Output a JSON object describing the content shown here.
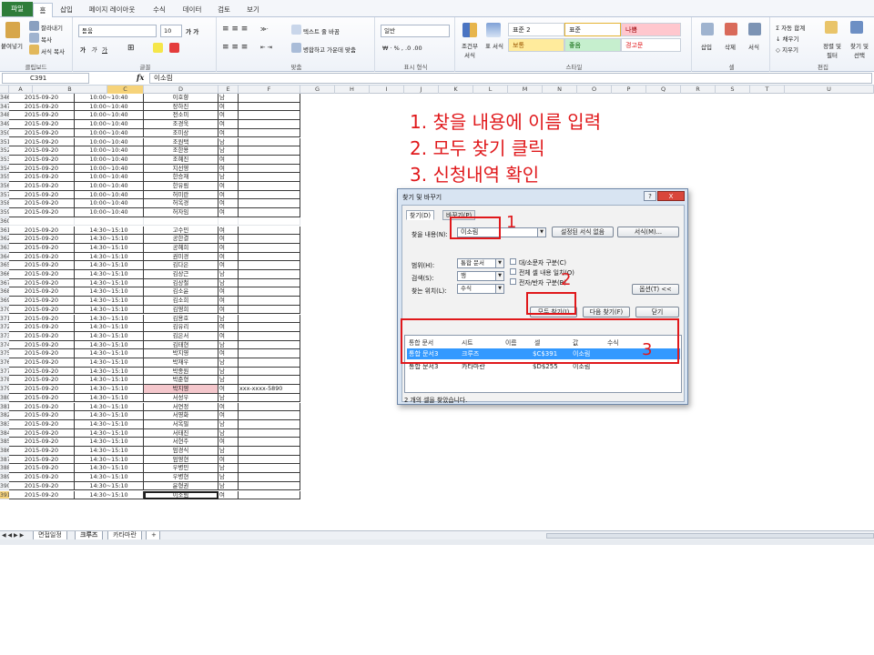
{
  "ribbon": {
    "tabs": [
      "파일",
      "홈",
      "삽입",
      "페이지 레이아웃",
      "수식",
      "데이터",
      "검토",
      "보기"
    ],
    "clipboard": {
      "paste": "붙여넣기",
      "cut": "잘라내기",
      "copy": "복사",
      "format_painter": "서식 복사",
      "label": "클립보드"
    },
    "font": {
      "name": "돋움",
      "size": "10",
      "label": "글꼴"
    },
    "alignment": {
      "wrap": "텍스트 줄 바꿈",
      "merge": "병합하고 가운데 맞춤",
      "label": "맞춤"
    },
    "number": {
      "format": "일반",
      "label": "표시 형식"
    },
    "styles": {
      "conditional": "조건부 서식",
      "table": "표 서식",
      "cells": [
        "표준 2",
        "표준",
        "나쁨",
        "보통",
        "좋음",
        "경고문"
      ],
      "label": "스타일"
    },
    "cells": {
      "insert": "삽입",
      "delete": "삭제",
      "format": "서식",
      "label": "셀"
    },
    "editing": {
      "autosum": "자동 합계",
      "fill": "채우기",
      "clear": "지우기",
      "sort": "정렬 및 필터",
      "find": "찾기 및 선택",
      "label": "편집"
    }
  },
  "formula_bar": {
    "name_box": "C391",
    "fx": "fx",
    "content": "이소림"
  },
  "columns": [
    "A",
    "B",
    "C",
    "D",
    "E",
    "F",
    "G",
    "H",
    "I",
    "J",
    "K",
    "L",
    "M",
    "N",
    "O",
    "P",
    "Q",
    "R",
    "S",
    "T",
    "U"
  ],
  "rows": [
    {
      "num": "346",
      "a": "2015-09-20",
      "b": "10:00~10:40",
      "c": "이호향",
      "d": "남"
    },
    {
      "num": "347",
      "a": "2015-09-20",
      "b": "10:00~10:40",
      "c": "장하진",
      "d": "여"
    },
    {
      "num": "348",
      "a": "2015-09-20",
      "b": "10:00~10:40",
      "c": "전소미",
      "d": "여"
    },
    {
      "num": "349",
      "a": "2015-09-20",
      "b": "10:00~10:40",
      "c": "조경욱",
      "d": "여"
    },
    {
      "num": "350",
      "a": "2015-09-20",
      "b": "10:00~10:40",
      "c": "조미상",
      "d": "여"
    },
    {
      "num": "351",
      "a": "2015-09-20",
      "b": "10:00~10:40",
      "c": "조원택",
      "d": "남"
    },
    {
      "num": "352",
      "a": "2015-09-20",
      "b": "10:00~10:40",
      "c": "조한용",
      "d": "남"
    },
    {
      "num": "353",
      "a": "2015-09-20",
      "b": "10:00~10:40",
      "c": "조혜진",
      "d": "여"
    },
    {
      "num": "354",
      "a": "2015-09-20",
      "b": "10:00~10:40",
      "c": "지선영",
      "d": "여"
    },
    {
      "num": "355",
      "a": "2015-09-20",
      "b": "10:00~10:40",
      "c": "한승재",
      "d": "남"
    },
    {
      "num": "356",
      "a": "2015-09-20",
      "b": "10:00~10:40",
      "c": "한유림",
      "d": "여"
    },
    {
      "num": "357",
      "a": "2015-09-20",
      "b": "10:00~10:40",
      "c": "허미란",
      "d": "여"
    },
    {
      "num": "358",
      "a": "2015-09-20",
      "b": "10:00~10:40",
      "c": "허옥경",
      "d": "여"
    },
    {
      "num": "359",
      "a": "2015-09-20",
      "b": "10:00~10:40",
      "c": "허자임",
      "d": "여"
    },
    {
      "num": "360",
      "a": "",
      "b": "",
      "c": "",
      "d": "",
      "blank": true
    },
    {
      "num": "361",
      "a": "2015-09-20",
      "b": "14:30~15:10",
      "c": "고수민",
      "d": "여"
    },
    {
      "num": "362",
      "a": "2015-09-20",
      "b": "14:30~15:10",
      "c": "공한결",
      "d": "여"
    },
    {
      "num": "363",
      "a": "2015-09-20",
      "b": "14:30~15:10",
      "c": "공혜희",
      "d": "여"
    },
    {
      "num": "364",
      "a": "2015-09-20",
      "b": "14:30~15:10",
      "c": "권미경",
      "d": "여"
    },
    {
      "num": "365",
      "a": "2015-09-20",
      "b": "14:30~15:10",
      "c": "김다은",
      "d": "여"
    },
    {
      "num": "366",
      "a": "2015-09-20",
      "b": "14:30~15:10",
      "c": "김상근",
      "d": "남"
    },
    {
      "num": "367",
      "a": "2015-09-20",
      "b": "14:30~15:10",
      "c": "김상철",
      "d": "남"
    },
    {
      "num": "368",
      "a": "2015-09-20",
      "b": "14:30~15:10",
      "c": "김소윤",
      "d": "여"
    },
    {
      "num": "369",
      "a": "2015-09-20",
      "b": "14:30~15:10",
      "c": "김소희",
      "d": "여"
    },
    {
      "num": "370",
      "a": "2015-09-20",
      "b": "14:30~15:10",
      "c": "김영희",
      "d": "여"
    },
    {
      "num": "371",
      "a": "2015-09-20",
      "b": "14:30~15:10",
      "c": "김용호",
      "d": "남"
    },
    {
      "num": "372",
      "a": "2015-09-20",
      "b": "14:30~15:10",
      "c": "김유리",
      "d": "여"
    },
    {
      "num": "373",
      "a": "2015-09-20",
      "b": "14:30~15:10",
      "c": "김은서",
      "d": "여"
    },
    {
      "num": "374",
      "a": "2015-09-20",
      "b": "14:30~15:10",
      "c": "김태현",
      "d": "남"
    },
    {
      "num": "375",
      "a": "2015-09-20",
      "b": "14:30~15:10",
      "c": "박지영",
      "d": "여"
    },
    {
      "num": "376",
      "a": "2015-09-20",
      "b": "14:30~15:10",
      "c": "박재우",
      "d": "남"
    },
    {
      "num": "377",
      "a": "2015-09-20",
      "b": "14:30~15:10",
      "c": "박종원",
      "d": "남"
    },
    {
      "num": "378",
      "a": "2015-09-20",
      "b": "14:30~15:10",
      "c": "박준형",
      "d": "남"
    },
    {
      "num": "379",
      "a": "2015-09-20",
      "b": "14:30~15:10",
      "c": "박지영",
      "d": "여",
      "e": "xxx-xxxx-5890",
      "pink": true
    },
    {
      "num": "380",
      "a": "2015-09-20",
      "b": "14:30~15:10",
      "c": "서성우",
      "d": "남"
    },
    {
      "num": "381",
      "a": "2015-09-20",
      "b": "14:30~15:10",
      "c": "서연정",
      "d": "여"
    },
    {
      "num": "382",
      "a": "2015-09-20",
      "b": "14:30~15:10",
      "c": "서영화",
      "d": "여"
    },
    {
      "num": "383",
      "a": "2015-09-20",
      "b": "14:30~15:10",
      "c": "서옥필",
      "d": "남"
    },
    {
      "num": "384",
      "a": "2015-09-20",
      "b": "14:30~15:10",
      "c": "서태진",
      "d": "남"
    },
    {
      "num": "385",
      "a": "2015-09-20",
      "b": "14:30~15:10",
      "c": "서현주",
      "d": "여"
    },
    {
      "num": "386",
      "a": "2015-09-20",
      "b": "14:30~15:10",
      "c": "엄경식",
      "d": "남"
    },
    {
      "num": "387",
      "a": "2015-09-20",
      "b": "14:30~15:10",
      "c": "엄영현",
      "d": "여"
    },
    {
      "num": "388",
      "a": "2015-09-20",
      "b": "14:30~15:10",
      "c": "우병민",
      "d": "남"
    },
    {
      "num": "389",
      "a": "2015-09-20",
      "b": "14:30~15:10",
      "c": "우병현",
      "d": "남"
    },
    {
      "num": "390",
      "a": "2015-09-20",
      "b": "14:30~15:10",
      "c": "윤형권",
      "d": "남"
    },
    {
      "num": "391",
      "a": "2015-09-20",
      "b": "14:30~15:10",
      "c": "이소림",
      "d": "여",
      "active": true
    }
  ],
  "sheet_tabs": [
    "면접일정",
    "크루즈",
    "카타마란"
  ],
  "instructions": [
    "1.  찾을 내용에 이름 입력",
    "2.  모두 찾기 클릭",
    "3.  신청내역 확인"
  ],
  "markers": [
    "1",
    "2",
    "3"
  ],
  "dialog": {
    "title": "찾기 및 바꾸기",
    "help": "?",
    "close": "X",
    "tabs": [
      "찾기(D)",
      "바꾸기(P)"
    ],
    "find_label": "찾을 내용(N):",
    "find_value": "이소림",
    "format_state": "설정된 서식 없음",
    "format_button": "서식(M)...",
    "scope_label": "범위(H):",
    "scope_value": "통합 문서",
    "search_label": "검색(S):",
    "search_value": "행",
    "lookin_label": "찾는 위치(L):",
    "lookin_value": "수식",
    "options": [
      "대/소문자 구분(C)",
      "전체 셀 내용 일치(O)",
      "전자/반자 구분(B)"
    ],
    "options_button": "옵션(T) <<",
    "find_all": "모두 찾기(I)",
    "find_next": "다음 찾기(F)",
    "close_button": "닫기",
    "result_headers": [
      "통합 문서",
      "시트",
      "이름",
      "셀",
      "값",
      "수식"
    ],
    "results": [
      {
        "book": "통합 문서3",
        "sheet": "크루즈",
        "cell": "$C$391",
        "value": "이소림"
      },
      {
        "book": "통합 문서3",
        "sheet": "카타마란",
        "cell": "$D$255",
        "value": "이소림"
      }
    ],
    "status": "2 개의 셀을 찾았습니다."
  },
  "colors": {
    "annotation": "#e0181b",
    "selection": "#3399ff",
    "file_tab": "#2f7d3a",
    "highlight": "#f4c7cc"
  }
}
